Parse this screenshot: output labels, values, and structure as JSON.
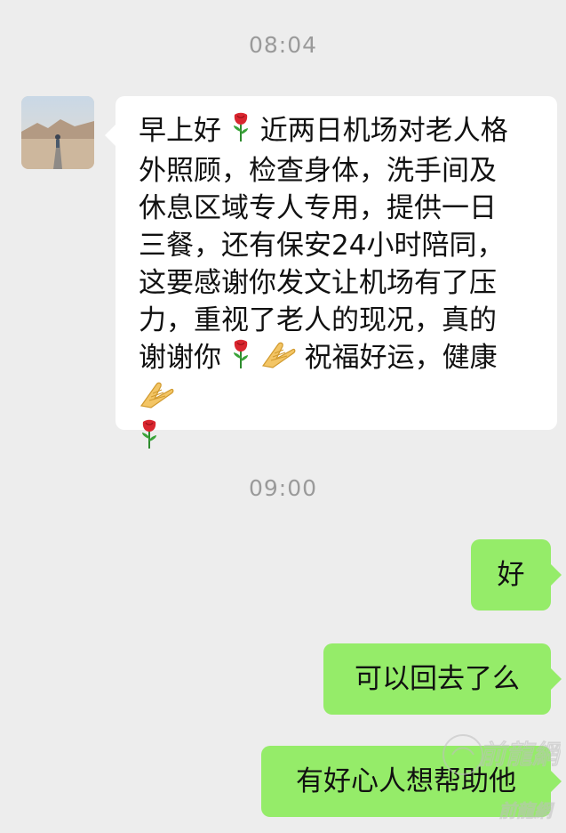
{
  "chat": {
    "timestamps": [
      "08:04",
      "09:00"
    ],
    "incoming": {
      "avatar_icon": "sender-avatar",
      "lines": [
        {
          "text": "早上好",
          "emoji_after": "rose-icon"
        },
        {
          "text": "近两日机场对老人格"
        },
        {
          "text": "外照顾，检查身体，洗手间及"
        },
        {
          "text": "休息区域专人专用，提供一日"
        },
        {
          "text": "三餐，还有保安24小时陪同，"
        },
        {
          "text": "这要感谢你发文让机场有了压"
        },
        {
          "text": "力，重视了老人的现况，真的"
        },
        {
          "text": "谢谢你"
        },
        {
          "text": "祝福好运，健康"
        }
      ]
    },
    "outgoing": [
      {
        "text": "好"
      },
      {
        "text": "可以回去了么"
      },
      {
        "text": "有好心人想帮助他"
      }
    ]
  },
  "colors": {
    "background": "#ededed",
    "incoming_bubble": "#ffffff",
    "outgoing_bubble": "#95ec69",
    "timestamp": "#9a9a9a"
  },
  "watermark": {
    "text": "前龍網"
  }
}
